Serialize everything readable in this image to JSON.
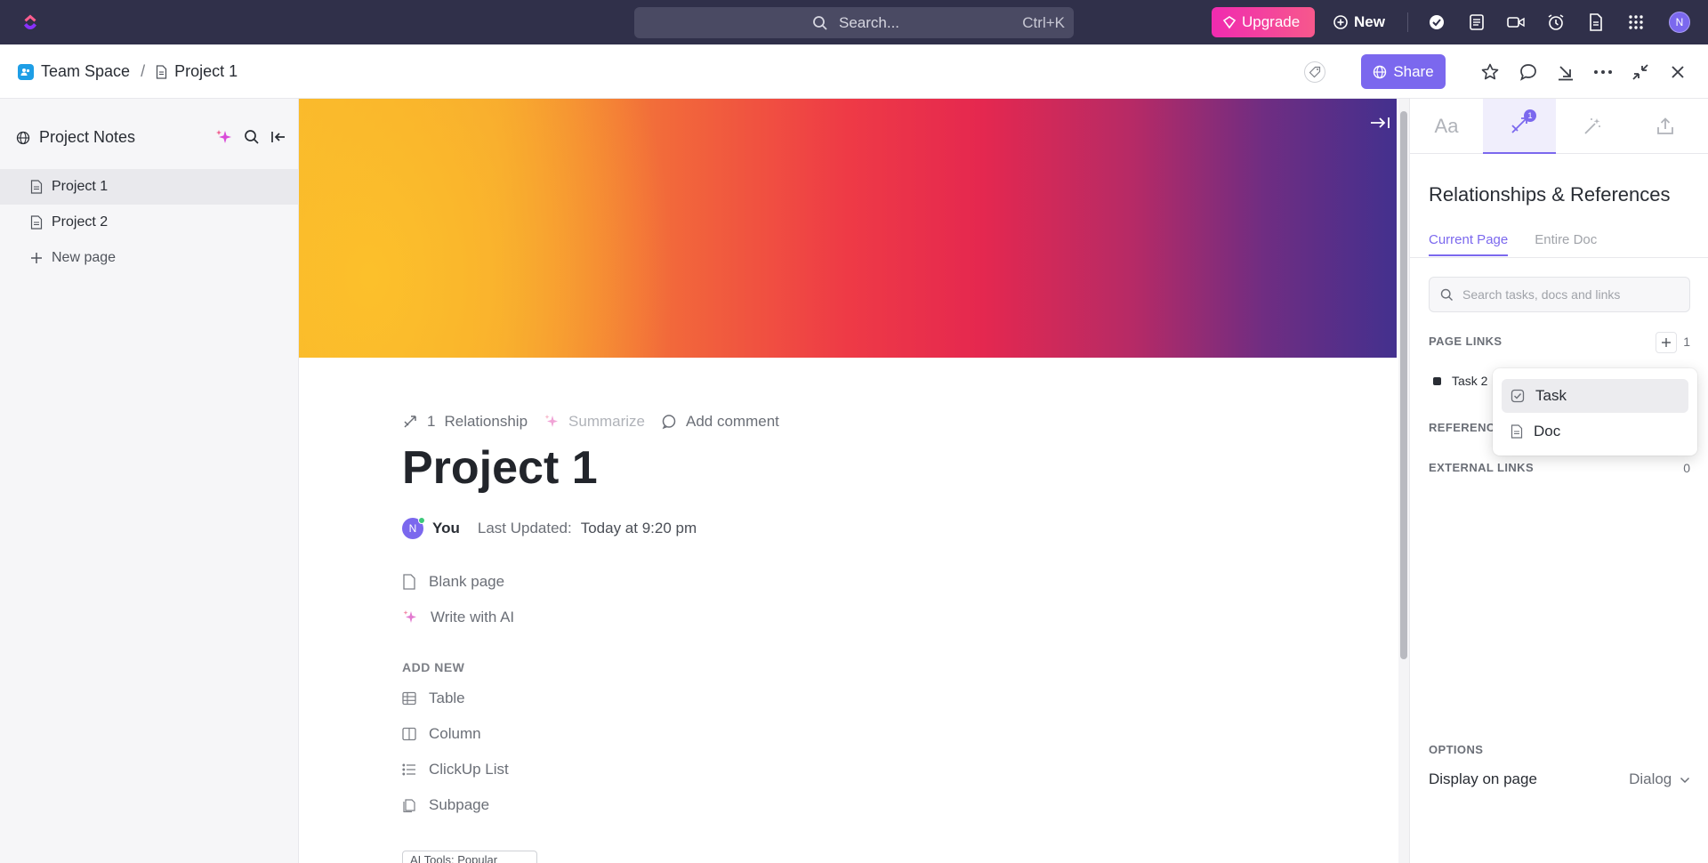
{
  "topbar": {
    "search_placeholder": "Search...",
    "search_shortcut": "Ctrl+K",
    "upgrade_label": "Upgrade",
    "new_label": "New",
    "avatar_initial": "N",
    "icons": [
      "check-circle-icon",
      "notepad-icon",
      "video-icon",
      "alarm-icon",
      "doc-icon",
      "apps-grid-icon"
    ]
  },
  "header": {
    "breadcrumb": {
      "space": "Team Space",
      "separator": "/",
      "doc": "Project 1"
    },
    "share_label": "Share"
  },
  "sidebar": {
    "title": "Project Notes",
    "items": [
      {
        "label": "Project 1",
        "active": true
      },
      {
        "label": "Project 2",
        "active": false
      }
    ],
    "new_page_label": "New page"
  },
  "doc": {
    "relationship_count": "1",
    "relationship_label": "Relationship",
    "summarize_label": "Summarize",
    "add_comment_label": "Add comment",
    "title": "Project 1",
    "author_initial": "N",
    "author": "You",
    "last_updated_label": "Last Updated:",
    "last_updated_value": "Today at 9:20 pm",
    "blank_page_label": "Blank page",
    "write_ai_label": "Write with AI",
    "add_new_label": "ADD NEW",
    "add_new_items": [
      "Table",
      "Column",
      "ClickUp List",
      "Subpage"
    ],
    "ai_tools_label": "AI Tools: Popular"
  },
  "right_panel": {
    "tabs": [
      "Aa",
      "relationships",
      "magic",
      "export"
    ],
    "relationships_badge": "1",
    "title": "Relationships & References",
    "subtabs": {
      "current": "Current Page",
      "entire": "Entire Doc"
    },
    "search_placeholder": "Search tasks, docs and links",
    "page_links_label": "PAGE LINKS",
    "page_links_count": "1",
    "page_link_item": "Task 2",
    "references_label": "REFERENCES",
    "external_links_label": "EXTERNAL LINKS",
    "external_links_count": "0",
    "options_label": "OPTIONS",
    "display_label": "Display on page",
    "display_value": "Dialog"
  },
  "dropdown": {
    "items": [
      {
        "label": "Task",
        "highlighted": true
      },
      {
        "label": "Doc",
        "highlighted": false
      }
    ]
  },
  "colors": {
    "topbar_bg": "#30304a",
    "accent": "#7b68ee",
    "upgrade_start": "#f02bb0",
    "upgrade_end": "#f7588c"
  }
}
